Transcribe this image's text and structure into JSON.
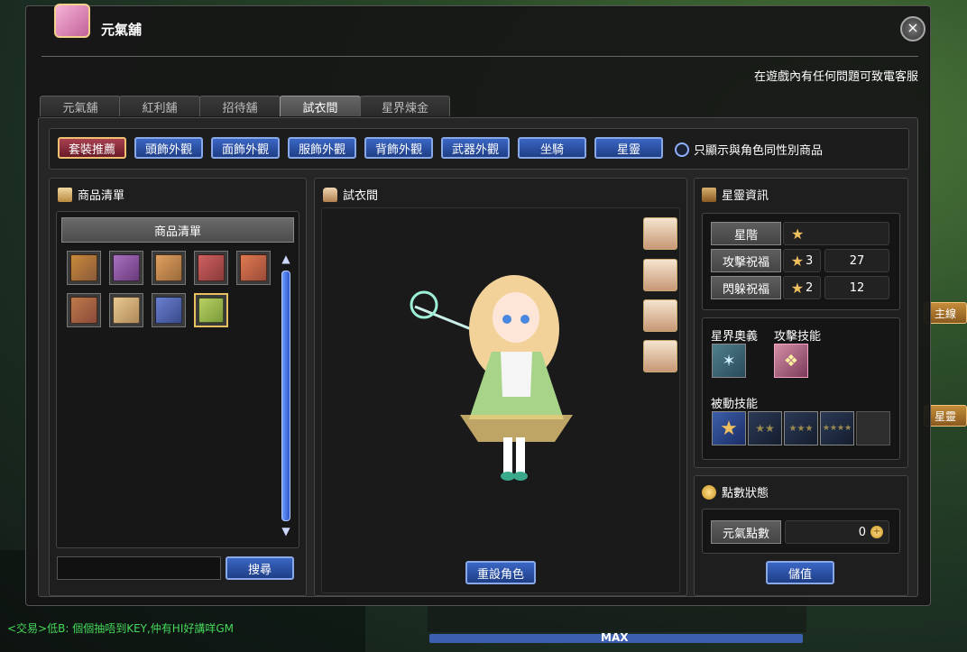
{
  "window": {
    "title": "元氣舖",
    "notice": "在遊戲內有任何問題可致電客服"
  },
  "tabs": [
    {
      "label": "元氣舖"
    },
    {
      "label": "紅利舖"
    },
    {
      "label": "招待舖"
    },
    {
      "label": "試衣間"
    },
    {
      "label": "星界煉金"
    }
  ],
  "categories": [
    {
      "label": "套裝推薦"
    },
    {
      "label": "頭飾外觀"
    },
    {
      "label": "面飾外觀"
    },
    {
      "label": "服飾外觀"
    },
    {
      "label": "背飾外觀"
    },
    {
      "label": "武器外觀"
    },
    {
      "label": "坐騎"
    },
    {
      "label": "星靈"
    }
  ],
  "filter": {
    "label": "只顯示與角色同性別商品"
  },
  "product_list": {
    "title": "商品清單",
    "header": "商品清單",
    "search_button": "搜尋",
    "items": [
      {
        "color": "#8a5a3a",
        "accent": "#c98a3a"
      },
      {
        "color": "#6a3a7a",
        "accent": "#a870c0"
      },
      {
        "color": "#9a6a3a",
        "accent": "#e0a060"
      },
      {
        "color": "#8a3a3a",
        "accent": "#d06060"
      },
      {
        "color": "#9a4a3a",
        "accent": "#e07a50"
      },
      {
        "color": "#8a4a3a",
        "accent": "#c07a4a"
      },
      {
        "color": "#b08a5a",
        "accent": "#e8c890"
      },
      {
        "color": "#3a4a8a",
        "accent": "#6a80d0"
      },
      {
        "color": "#7a9a3a",
        "accent": "#b8d060"
      }
    ]
  },
  "fitting_room": {
    "title": "試衣間",
    "reset_button": "重設角色"
  },
  "spirit_info": {
    "title": "星靈資訊",
    "rows": [
      {
        "label": "星階",
        "stars": "",
        "value": ""
      },
      {
        "label": "攻擊祝福",
        "stars": "3",
        "value": "27"
      },
      {
        "label": "閃躲祝福",
        "stars": "2",
        "value": "12"
      }
    ],
    "astral_label": "星界奧義",
    "attack_skill_label": "攻擊技能",
    "passive_label": "被動技能"
  },
  "points": {
    "title": "點數狀態",
    "label": "元氣點數",
    "value": "0",
    "charge_button": "儲值"
  },
  "background": {
    "chat_line": "<交易>低B: 個個抽唔到KEY,仲有HI好講咩GM",
    "exp_label": "MAX",
    "side_btn_1": "主線",
    "side_btn_2": "星靈"
  }
}
